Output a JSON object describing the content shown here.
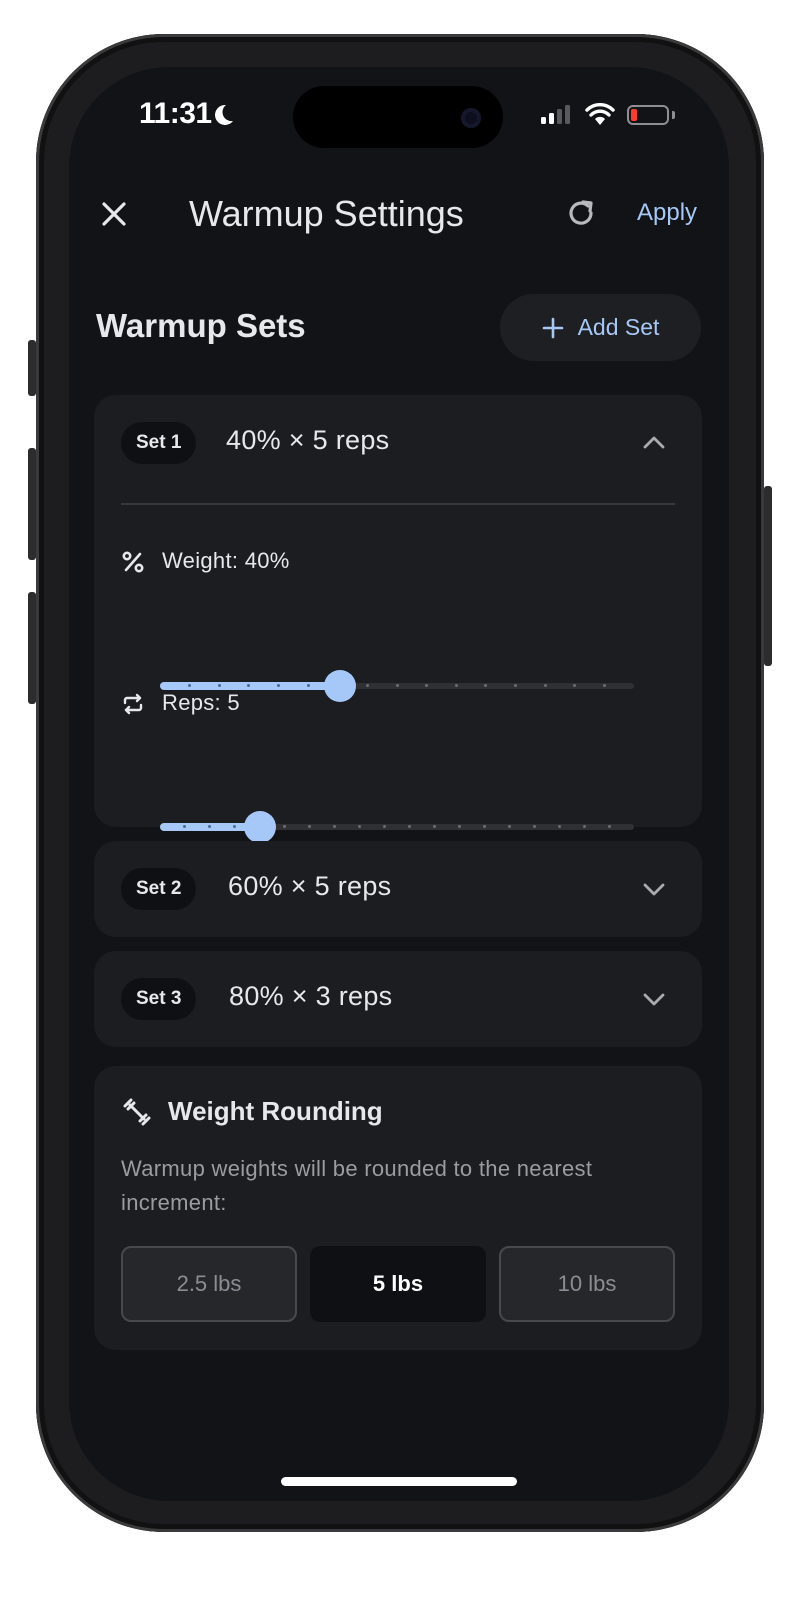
{
  "status_bar": {
    "time": "11:31",
    "battery_color": "#ff3b30"
  },
  "header": {
    "title": "Warmup Settings",
    "apply_label": "Apply"
  },
  "warmup_sets": {
    "title": "Warmup Sets",
    "add_set_label": "Add Set",
    "sets": [
      {
        "badge": "Set 1",
        "summary": "40% × 5 reps",
        "expanded": true
      },
      {
        "badge": "Set 2",
        "summary": "60% × 5 reps",
        "expanded": false
      },
      {
        "badge": "Set 3",
        "summary": "80% × 3 reps",
        "expanded": false
      }
    ],
    "set1": {
      "weight_label": "Weight: 40%",
      "weight_value_fraction": 0.38,
      "reps_label": "Reps: 5",
      "reps_value_fraction": 0.21
    }
  },
  "rounding": {
    "title": "Weight Rounding",
    "description": "Warmup weights will be rounded to the nearest increment:",
    "options": [
      "2.5 lbs",
      "5 lbs",
      "10 lbs"
    ],
    "selected": "5 lbs"
  },
  "colors": {
    "accent": "#a6c8f8",
    "link": "#a7c8f4",
    "background": "#121316",
    "card": "#1b1d21"
  },
  "icons": [
    "close-icon",
    "refresh-icon",
    "plus-icon",
    "chevron-up-icon",
    "chevron-down-icon",
    "percent-icon",
    "repeat-icon",
    "dumbbell-icon"
  ]
}
